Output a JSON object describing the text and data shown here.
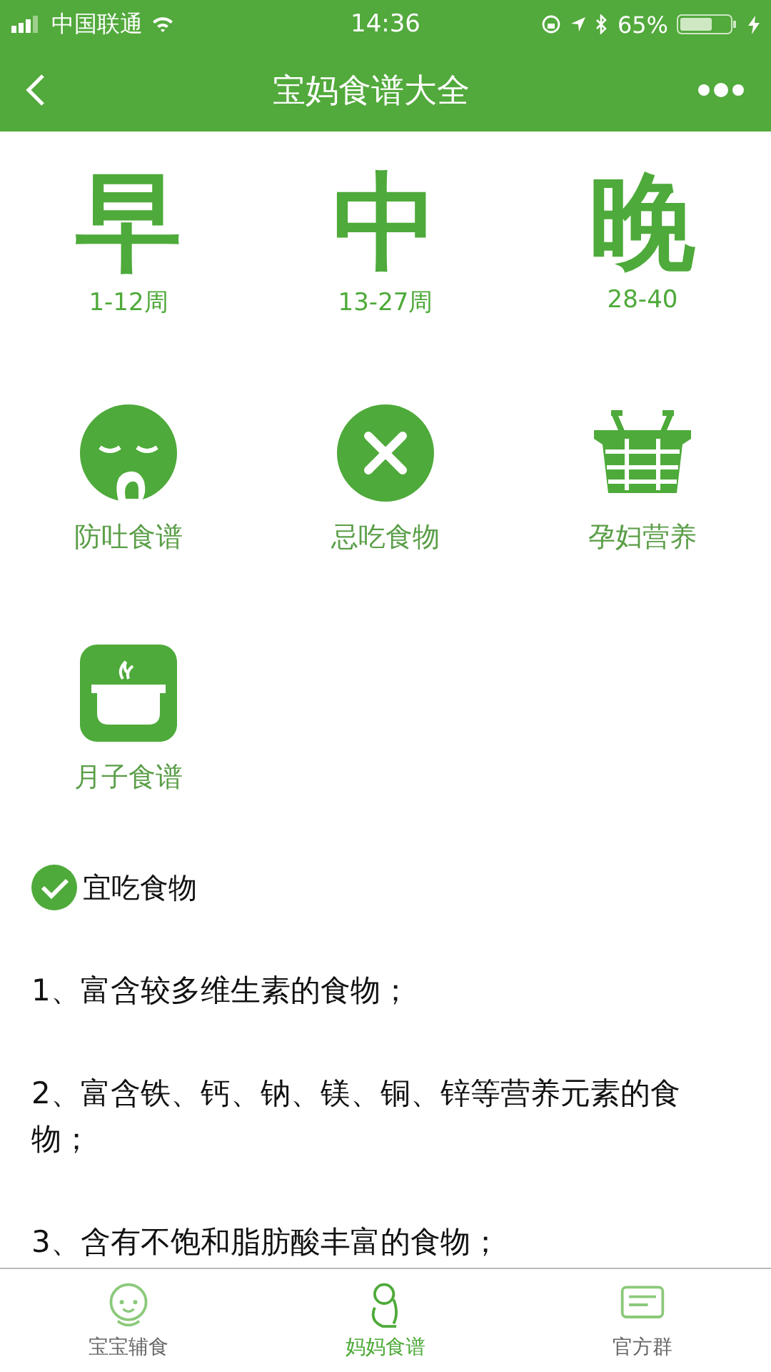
{
  "status_bar": {
    "carrier": "中国联通",
    "time": "14:36",
    "battery": "65%"
  },
  "nav": {
    "title": "宝妈食谱大全"
  },
  "periods": [
    {
      "char": "早",
      "weeks": "1-12周"
    },
    {
      "char": "中",
      "weeks": "13-27周"
    },
    {
      "char": "晚",
      "weeks": "28-40"
    }
  ],
  "categories": [
    {
      "kind": "nausea",
      "label": "防吐食谱"
    },
    {
      "kind": "forbidden",
      "label": "忌吃食物"
    },
    {
      "kind": "basket",
      "label": "孕妇营养"
    },
    {
      "kind": "pot",
      "label": "月子食谱"
    }
  ],
  "section": {
    "title": "宜吃食物",
    "items": [
      "1、富含较多维生素的食物；",
      "2、富含铁、钙、钠、镁、铜、锌等营养元素的食物；",
      "3、含有不饱和脂肪酸丰富的食物；"
    ]
  },
  "tab_bar": [
    {
      "kind": "baby",
      "label": "宝宝辅食",
      "selected": false
    },
    {
      "kind": "mom",
      "label": "妈妈食谱",
      "selected": true
    },
    {
      "kind": "chat",
      "label": "官方群",
      "selected": false
    }
  ]
}
